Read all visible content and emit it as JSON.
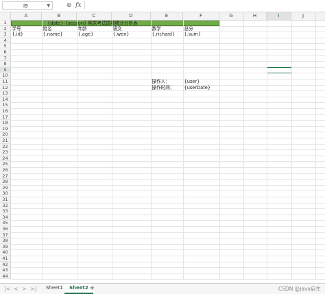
{
  "formula_bar": {
    "name_box": "I9",
    "zoom_icon": "zoom-icon",
    "fx_label": "fx",
    "formula": ""
  },
  "columns": [
    "A",
    "B",
    "C",
    "D",
    "E",
    "F",
    "G",
    "H",
    "I",
    "J"
  ],
  "selected_column": "I",
  "selected_row": 9,
  "row_count": 44,
  "cells": {
    "title": "{date}-{season}   期末考试成绩统计分析表",
    "headers": [
      "学号",
      "姓名",
      "年龄",
      "语文",
      "数学",
      "总分"
    ],
    "fields": [
      "{.id}",
      "{.name}",
      "{.age}",
      "{.wen}",
      "{.richard}",
      "{.sum}"
    ],
    "operator_label": "操作人：",
    "operator_value": "{user}",
    "optime_label": "操作时间：",
    "optime_value": "{userDate}"
  },
  "tabs": {
    "nav": [
      "|<",
      "<",
      ">",
      ">|"
    ],
    "sheets": [
      "Sheet1",
      "Sheet2"
    ],
    "active": "Sheet2",
    "add": "+"
  },
  "watermark": "CSDN @java启生",
  "colors": {
    "title_band": "#70ad47",
    "accent": "#217346"
  }
}
